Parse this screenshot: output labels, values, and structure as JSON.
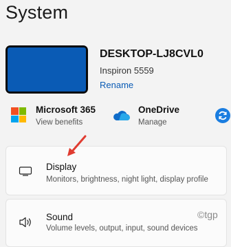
{
  "header": {
    "title": "System"
  },
  "device": {
    "name": "DESKTOP-LJ8CVL0",
    "model": "Inspiron 5559",
    "rename_label": "Rename"
  },
  "services": [
    {
      "title": "Microsoft 365",
      "subtitle": "View benefits",
      "icon": "microsoft-logo"
    },
    {
      "title": "OneDrive",
      "subtitle": "Manage",
      "icon": "onedrive-cloud"
    }
  ],
  "settings": [
    {
      "title": "Display",
      "description": "Monitors, brightness, night light, display profile",
      "icon": "monitor-icon"
    },
    {
      "title": "Sound",
      "description": "Volume levels, output, input, sound devices",
      "icon": "speaker-icon"
    }
  ],
  "watermark": "©tgp",
  "colors": {
    "accent": "#0a5bb5",
    "annotation_arrow": "#e03c31",
    "background": "#f3f3f3"
  }
}
